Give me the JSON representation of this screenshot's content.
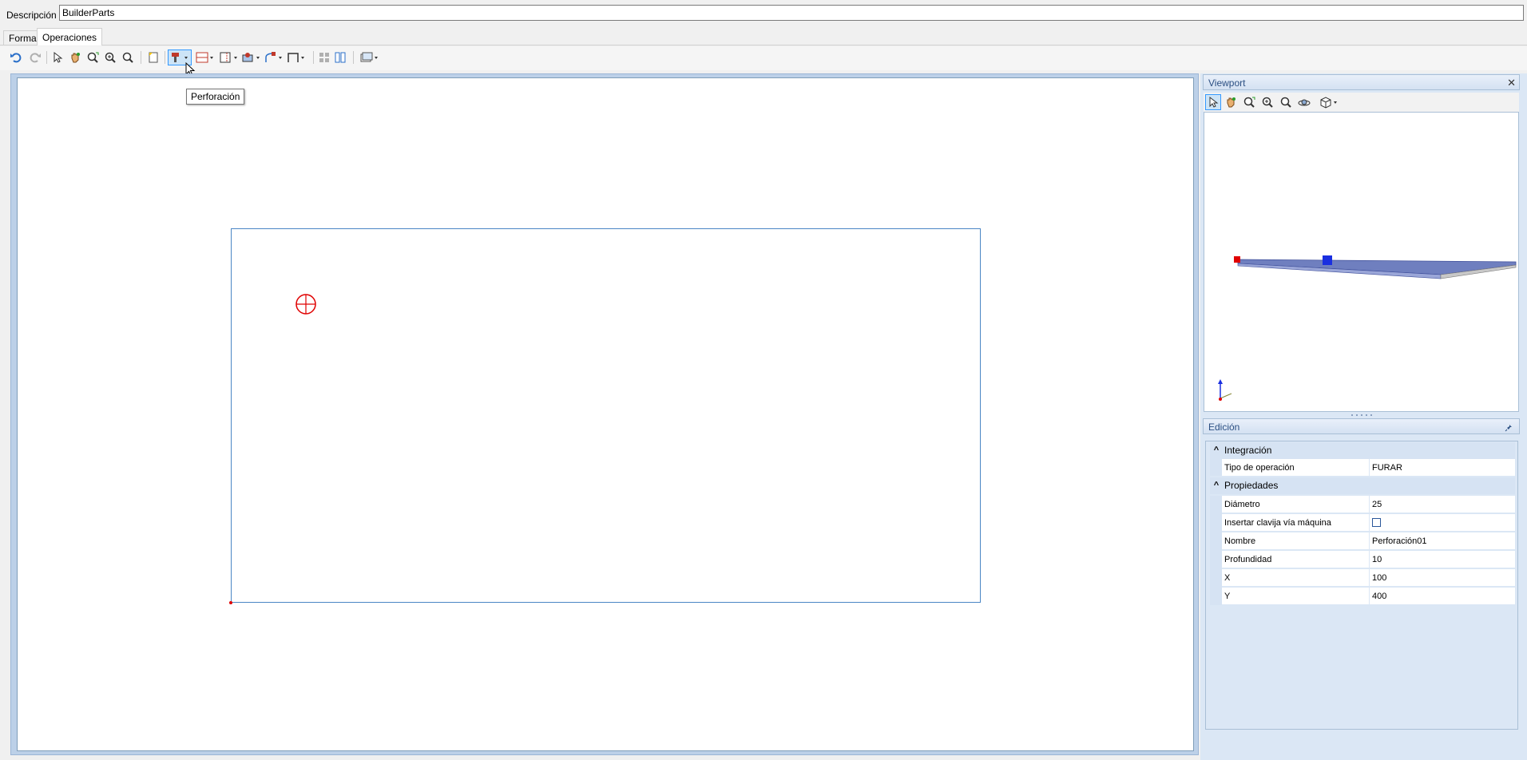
{
  "description": {
    "label": "Descripción",
    "value": "BuilderParts"
  },
  "tabs": [
    {
      "label": "Forma",
      "active": false
    },
    {
      "label": "Operaciones",
      "active": true
    }
  ],
  "toolbar": {
    "icons": [
      "undo-icon",
      "redo-icon",
      "select-arrow-icon",
      "pan-hand-icon",
      "zoom-extents-icon",
      "zoom-in-icon",
      "zoom-window-icon",
      "new-document-icon",
      "drill-icon",
      "panel-cut-icon",
      "groove-icon",
      "pocket-icon",
      "contour-icon",
      "frame-icon",
      "grid-array-icon",
      "mirror-icon",
      "view-options-icon"
    ],
    "tooltip": "Perforación"
  },
  "viewport": {
    "title": "Viewport",
    "icons": [
      "select-arrow-icon",
      "pan-hand-icon",
      "zoom-extents-icon",
      "zoom-in-icon",
      "zoom-window-icon",
      "orbit-icon",
      "view-cube-icon"
    ]
  },
  "edicion": {
    "title": "Edición",
    "categories": [
      {
        "label": "Integración",
        "rows": [
          {
            "name": "Tipo de operación",
            "value": "FURAR"
          }
        ]
      },
      {
        "label": "Propiedades",
        "rows": [
          {
            "name": "Diámetro",
            "value": "25"
          },
          {
            "name": "Insertar clavija vía máquina",
            "value": "",
            "checkbox": true,
            "checked": false
          },
          {
            "name": "Nombre",
            "value": "Perforación01"
          },
          {
            "name": "Profundidad",
            "value": "10"
          },
          {
            "name": "X",
            "value": "100"
          },
          {
            "name": "Y",
            "value": "400"
          }
        ]
      }
    ]
  },
  "colors": {
    "accent": "#3399ff",
    "part_outline": "#4a86c5",
    "drill_marker": "#e00000",
    "panel_bg": "#dbe7f5"
  }
}
